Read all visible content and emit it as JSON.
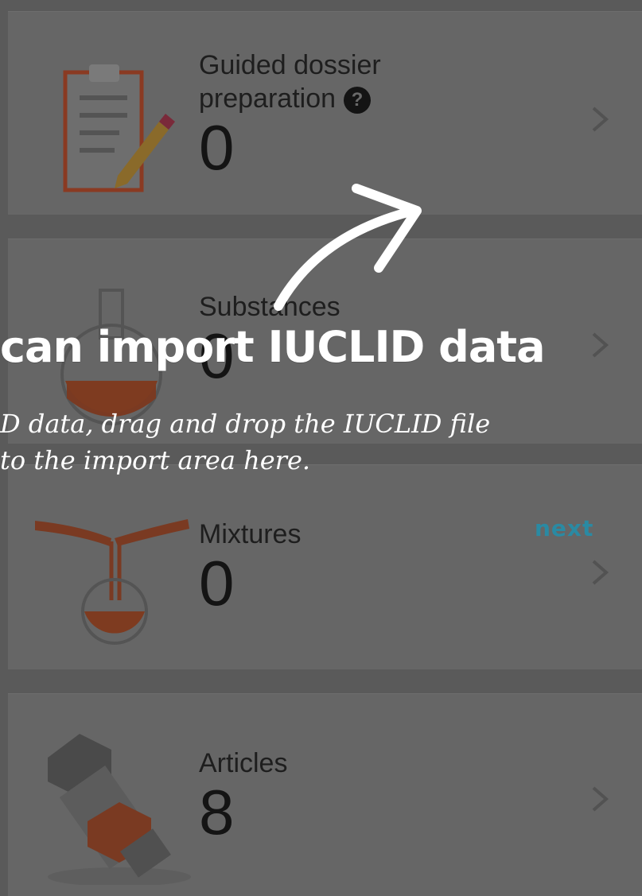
{
  "cards": [
    {
      "title_line1": "Guided dossier",
      "title_line2": "preparation",
      "count": "0",
      "icon": "clipboard-pencil-icon",
      "help": "?"
    },
    {
      "title": "Substances",
      "count": "0",
      "icon": "flask-icon"
    },
    {
      "title": "Mixtures",
      "count": "0",
      "icon": "pouring-flasks-icon"
    },
    {
      "title": "Articles",
      "count": "8",
      "icon": "bolt-nut-icon"
    }
  ],
  "tutorial": {
    "heading": "can import IUCLID data",
    "body_line1": "D data, drag and drop the IUCLID file",
    "body_line2": "to the import area here.",
    "next_label": "next"
  },
  "colors": {
    "overlay_bg": "#5a5a5a",
    "card_bg": "#666666",
    "text_dark": "#1e1e1e",
    "next_accent": "#2a8aa3",
    "illustration_orange": "#b4451f"
  }
}
